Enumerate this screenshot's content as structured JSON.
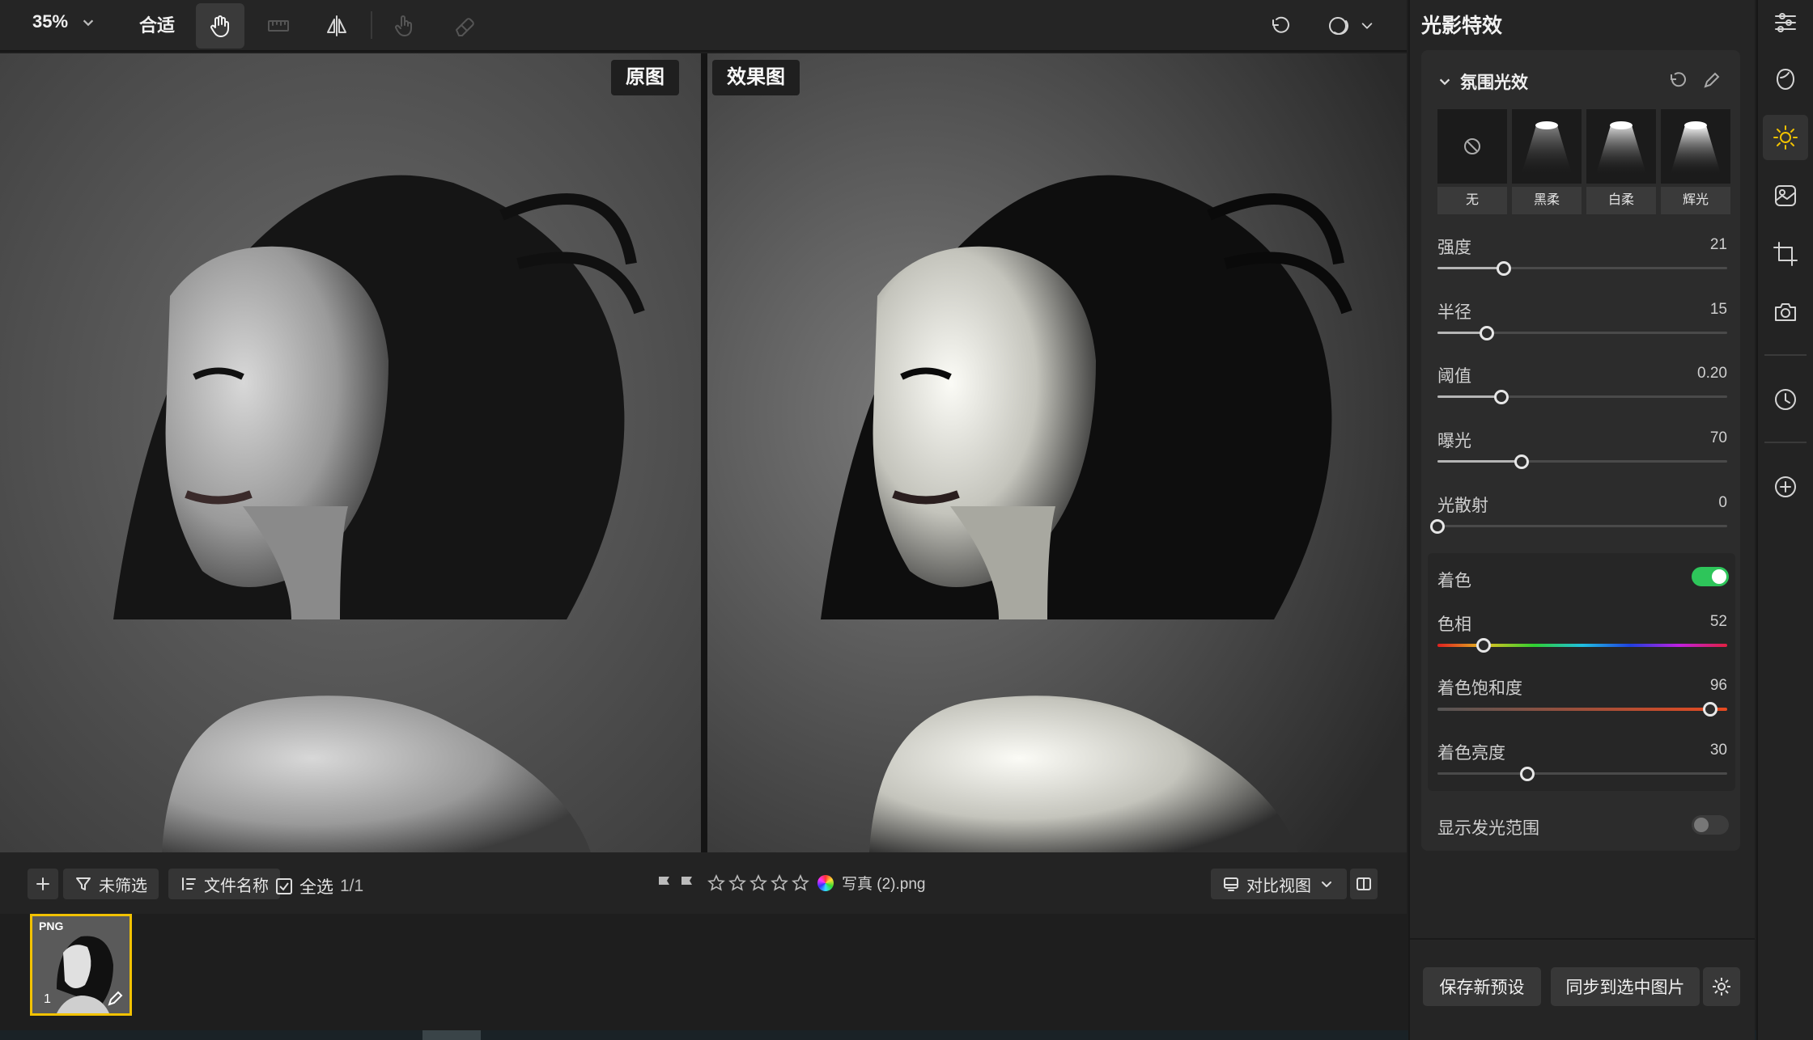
{
  "toolbar": {
    "zoom": "35%",
    "fit": "合适"
  },
  "canvas": {
    "original_label": "原图",
    "effect_label": "效果图"
  },
  "bottombar": {
    "filter_label": "未筛选",
    "sort_label": "文件名称",
    "select_all_label": "全选",
    "selection_count": "1/1",
    "filename": "写真 (2).png",
    "rating": 0,
    "view_mode": "对比视图"
  },
  "thumbnail": {
    "format": "PNG",
    "index": "1"
  },
  "panel": {
    "title": "光影特效",
    "section_title": "氛围光效",
    "presets": [
      {
        "label": "无",
        "icon": "none-icon"
      },
      {
        "label": "黑柔",
        "icon": "spotlight-icon"
      },
      {
        "label": "白柔",
        "icon": "spotlight-icon"
      },
      {
        "label": "辉光",
        "icon": "spotlight-icon"
      }
    ],
    "sliders": [
      {
        "label": "强度",
        "value": "21",
        "fraction": 0.23
      },
      {
        "label": "半径",
        "value": "15",
        "fraction": 0.17
      },
      {
        "label": "阈值",
        "value": "0.20",
        "fraction": 0.22
      },
      {
        "label": "曝光",
        "value": "70",
        "fraction": 0.29
      },
      {
        "label": "光散射",
        "value": "0",
        "fraction": 0.0
      }
    ],
    "colorize": {
      "label": "着色",
      "enabled": true,
      "hue": {
        "label": "色相",
        "value": "52",
        "fraction": 0.16
      },
      "saturation": {
        "label": "着色饱和度",
        "value": "96",
        "fraction": 0.94
      },
      "brightness": {
        "label": "着色亮度",
        "value": "30",
        "fraction": 0.31
      }
    },
    "show_glow_range": {
      "label": "显示发光范围",
      "enabled": false
    },
    "save_preset_label": "保存新预设",
    "sync_label": "同步到选中图片"
  },
  "colors": {
    "accent": "#f2c200",
    "toggle_on": "#2ec55a"
  }
}
